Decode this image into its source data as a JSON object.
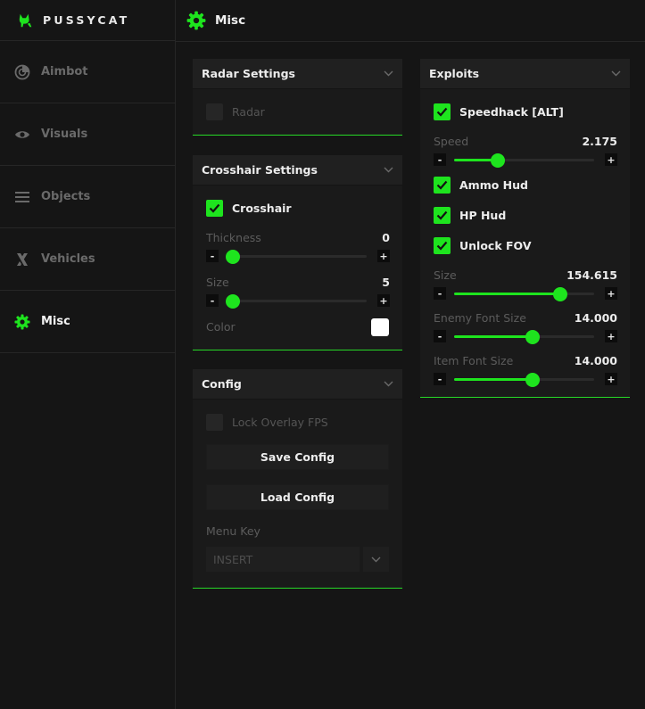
{
  "brand": {
    "name": "PUSSYCAT",
    "accent": "#1ee41e"
  },
  "sidebar": {
    "items": [
      {
        "label": "Aimbot",
        "icon": "radar-icon"
      },
      {
        "label": "Visuals",
        "icon": "eye-icon"
      },
      {
        "label": "Objects",
        "icon": "list-icon"
      },
      {
        "label": "Vehicles",
        "icon": "x-shape-icon"
      },
      {
        "label": "Misc",
        "icon": "gear-icon",
        "active": true
      }
    ]
  },
  "header": {
    "title": "Misc"
  },
  "radar_panel": {
    "title": "Radar Settings",
    "radar": {
      "label": "Radar",
      "checked": false
    }
  },
  "crosshair_panel": {
    "title": "Crosshair Settings",
    "crosshair": {
      "label": "Crosshair",
      "checked": true
    },
    "thickness": {
      "label": "Thickness",
      "value": "0",
      "fraction": 0
    },
    "size": {
      "label": "Size",
      "value": "5",
      "fraction": 0
    },
    "color": {
      "label": "Color",
      "value": "#ffffff"
    }
  },
  "config_panel": {
    "title": "Config",
    "lock_fps": {
      "label": "Lock Overlay FPS",
      "checked": false
    },
    "save_label": "Save Config",
    "load_label": "Load Config",
    "menu_key_label": "Menu Key",
    "menu_key_value": "INSERT"
  },
  "exploits_panel": {
    "title": "Exploits",
    "speedhack": {
      "label": "Speedhack [ALT]",
      "checked": true
    },
    "speed": {
      "label": "Speed",
      "value": "2.175",
      "fraction": 0.31
    },
    "ammo_hud": {
      "label": "Ammo Hud",
      "checked": true
    },
    "hp_hud": {
      "label": "HP Hud",
      "checked": true
    },
    "unlock_fov": {
      "label": "Unlock FOV",
      "checked": true
    },
    "fov_size": {
      "label": "Size",
      "value": "154.615",
      "fraction": 0.76
    },
    "enemy_font": {
      "label": "Enemy Font Size",
      "value": "14.000",
      "fraction": 0.56
    },
    "item_font": {
      "label": "Item Font Size",
      "value": "14.000",
      "fraction": 0.56
    }
  }
}
